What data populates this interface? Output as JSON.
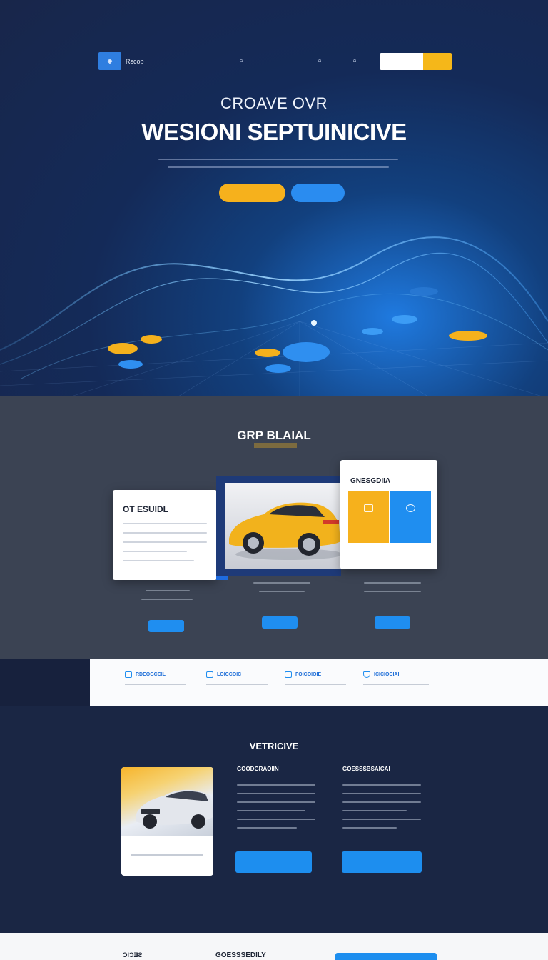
{
  "nav": {
    "brand": "Rƨcoɒ",
    "links": [
      "ᗝ",
      "ᗝ",
      "ᗝ"
    ],
    "search_placeholder": "",
    "cta_label": ""
  },
  "hero": {
    "pretitle": "CROAVE OVR",
    "title": "WESIONI SEPTUINICIVE",
    "primary_btn": "",
    "secondary_btn": "",
    "caption": ""
  },
  "section2": {
    "title": "GRP BLAIAL",
    "tag": "",
    "card1_title": "OT ESUIDL",
    "card3_title": "GNESGDIIA",
    "tile1_label": "",
    "tile2_label": "",
    "buttons": [
      "",
      "",
      ""
    ]
  },
  "features": {
    "items": [
      {
        "label": "RDEOGCCIL",
        "icon": "monitor-icon"
      },
      {
        "label": "LOICCOIC",
        "icon": "chart-icon"
      },
      {
        "label": "FOICOIOIE",
        "icon": "car-icon"
      },
      {
        "label": "ICICIOCIAI",
        "icon": "shield-icon"
      }
    ]
  },
  "section4": {
    "title": "VETRICIVE",
    "card_caption": "",
    "col1_title": "GOODGRAOIIN",
    "col2_title": "GOESSSBSAICAI",
    "col1_btn": "",
    "col2_btn": ""
  },
  "footer": {
    "label1": "ƆIƆƎƧ",
    "label2": "GOESSSEDILY"
  },
  "colors": {
    "accent_yellow": "#f6b11c",
    "accent_blue": "#1f8ef0",
    "hero_dark": "#18264a"
  }
}
